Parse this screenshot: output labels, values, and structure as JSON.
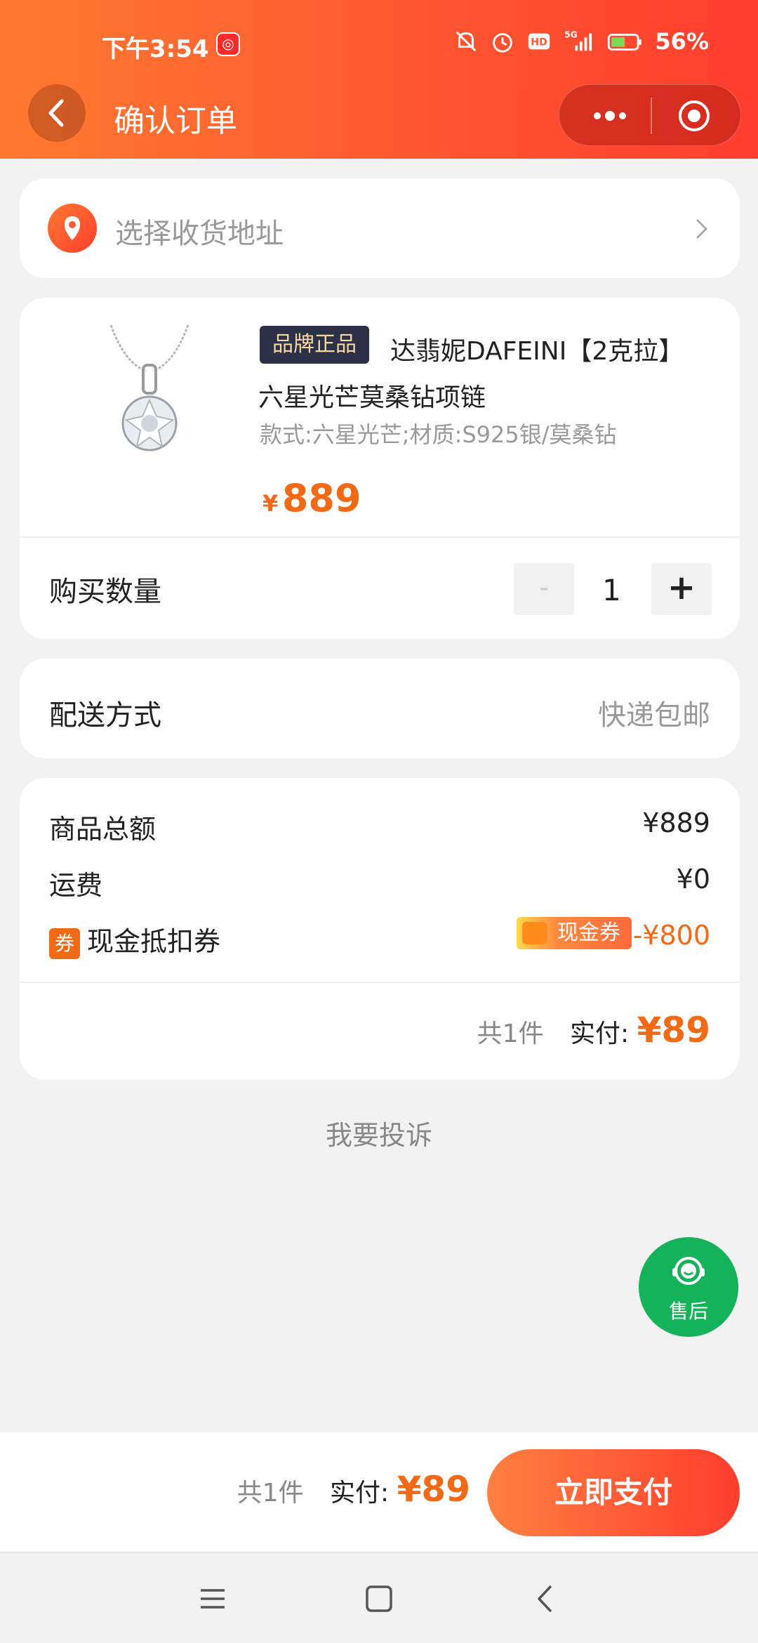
{
  "status_bar": {
    "time": "下午3:54",
    "network": "5G",
    "battery": "56%"
  },
  "header": {
    "title": "确认订单"
  },
  "address": {
    "placeholder": "选择收货地址"
  },
  "product": {
    "brand_tag": "品牌正品",
    "title": "达翡妮DAFEINI【2克拉】六星光芒莫桑钻项链",
    "spec": "款式:六星光芒;材质:S925银/莫桑钻",
    "price_currency": "¥",
    "price": "889",
    "quantity_label": "购买数量",
    "minus_label": "-",
    "quantity": "1",
    "plus_label": "+"
  },
  "delivery": {
    "label": "配送方式",
    "value": "快递包邮"
  },
  "summary": {
    "goods_label": "商品总额",
    "goods_value": "¥889",
    "shipping_label": "运费",
    "shipping_value": "¥0",
    "coupon_badge": "券",
    "coupon_label": "现金抵扣券",
    "coupon_pill": "现金券",
    "coupon_amount": "-¥800",
    "count": "共1件",
    "pay_label": "实付:",
    "pay_amount": "¥89"
  },
  "complaint": "我要投诉",
  "service": {
    "label": "售后"
  },
  "bottom_bar": {
    "count": "共1件",
    "pay_label": "实付:",
    "pay_amount": "¥89",
    "pay_button": "立即支付"
  },
  "colors": {
    "accent": "#f26a16",
    "header_start": "#ff7a30",
    "header_end": "#ff3d2e",
    "service_green": "#14b35a"
  }
}
